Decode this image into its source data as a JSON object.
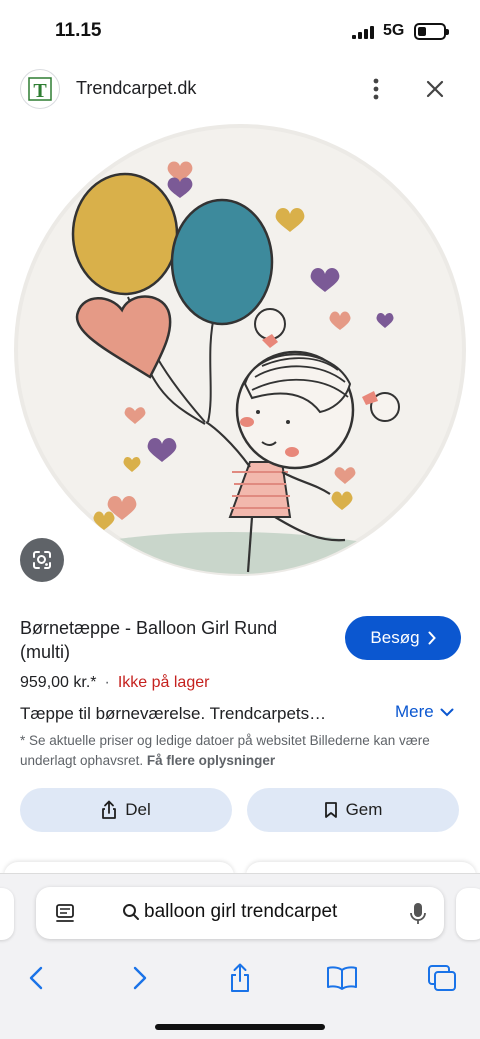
{
  "status_bar": {
    "time": "11.15",
    "network": "5G",
    "battery_level": 0.35
  },
  "header": {
    "site_logo_letter": "T",
    "site_name": "Trendcarpet.dk"
  },
  "product": {
    "title": "Børnetæppe - Balloon Girl Rund (multi)",
    "visit_label": "Besøg",
    "price": "959,00 kr.*",
    "separator": "·",
    "stock": "Ikke på lager",
    "description": "Tæppe til børneværelse. Trendcarpets…",
    "more_label": "Mere",
    "disclaimer": "* Se aktuelle priser og ledige datoer på websitet Billederne kan være underlagt ophavsret.",
    "disclaimer_link": "Få flere oplysninger"
  },
  "actions": {
    "share_label": "Del",
    "save_label": "Gem"
  },
  "browser": {
    "search_query": "balloon girl trendcarpet"
  },
  "colors": {
    "accent": "#0b57d0",
    "stock_red": "#c5221f",
    "action_bg": "#dfe8f6"
  }
}
